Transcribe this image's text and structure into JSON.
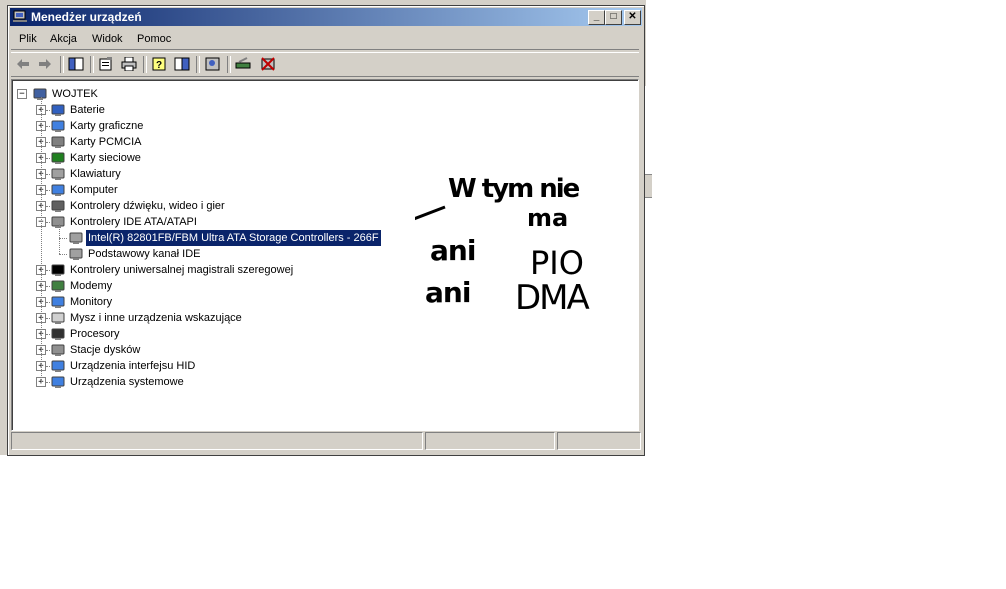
{
  "window": {
    "title": "Menedżer urządzeń",
    "controls": {
      "minimize": "_",
      "maximize": "□",
      "close": "✕"
    }
  },
  "menu": [
    "Plik",
    "Akcja",
    "Widok",
    "Pomoc"
  ],
  "toolbar": [
    "back-icon",
    "forward-icon",
    "show-hide-tree-icon",
    "properties-icon",
    "print-icon",
    "help-icon",
    "view-icon",
    "scan-hardware-icon",
    "update-driver-icon",
    "uninstall-icon"
  ],
  "tree": {
    "root": "WOJTEK",
    "categories": [
      {
        "label": "Baterie",
        "icon": "battery-icon"
      },
      {
        "label": "Karty graficzne",
        "icon": "display-adapter-icon"
      },
      {
        "label": "Karty PCMCIA",
        "icon": "pcmcia-icon"
      },
      {
        "label": "Karty sieciowe",
        "icon": "network-card-icon"
      },
      {
        "label": "Klawiatury",
        "icon": "keyboard-icon"
      },
      {
        "label": "Komputer",
        "icon": "computer-icon"
      },
      {
        "label": "Kontrolery dźwięku, wideo i gier",
        "icon": "sound-icon"
      },
      {
        "label": "Kontrolery IDE ATA/ATAPI",
        "icon": "ide-controller-icon",
        "expanded": true,
        "children": [
          "Intel(R) 82801FB/FBM Ultra ATA Storage Controllers - 266F",
          "Podstawowy kanał IDE"
        ]
      },
      {
        "label": "Kontrolery uniwersalnej magistrali szeregowej",
        "icon": "usb-icon"
      },
      {
        "label": "Modemy",
        "icon": "modem-icon"
      },
      {
        "label": "Monitory",
        "icon": "monitor-icon"
      },
      {
        "label": "Mysz i inne urządzenia wskazujące",
        "icon": "mouse-icon"
      },
      {
        "label": "Procesory",
        "icon": "processor-icon"
      },
      {
        "label": "Stacje dysków",
        "icon": "disk-drive-icon"
      },
      {
        "label": "Urządzenia interfejsu HID",
        "icon": "hid-icon"
      },
      {
        "label": "Urządzenia systemowe",
        "icon": "system-device-icon"
      }
    ]
  },
  "annotation": [
    "W tym nie",
    "ma",
    "ani",
    "PIO",
    "ani",
    "DMA"
  ],
  "colors": {
    "selection": "#0a246a",
    "title_start": "#0a246a",
    "title_end": "#a6caf0",
    "face": "#d4d0c8"
  }
}
